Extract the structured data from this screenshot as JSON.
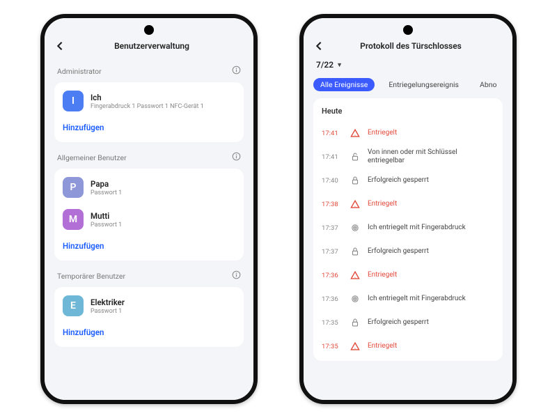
{
  "phone1": {
    "header": "Benutzerverwaltung",
    "sections": {
      "admin": {
        "label": "Administrator",
        "users": [
          {
            "initial": "I",
            "name": "Ich",
            "sub": "Fingerabdruck 1 Passwort 1 NFC-Gerät 1",
            "avatar": "blue"
          }
        ],
        "add": "Hinzufügen"
      },
      "general": {
        "label": "Allgemeiner Benutzer",
        "users": [
          {
            "initial": "P",
            "name": "Papa",
            "sub": "Passwort 1",
            "avatar": "purple"
          },
          {
            "initial": "M",
            "name": "Mutti",
            "sub": "Passwort 1",
            "avatar": "magenta"
          }
        ],
        "add": "Hinzufügen"
      },
      "temp": {
        "label": "Temporärer Benutzer",
        "users": [
          {
            "initial": "E",
            "name": "Elektriker",
            "sub": "Passwort 1",
            "avatar": "teal"
          }
        ],
        "add": "Hinzufügen"
      }
    }
  },
  "phone2": {
    "header": "Protokoll des Türschlosses",
    "date": "7/22",
    "chips": {
      "all": "Alle Ereignisse",
      "unlock": "Entriegelungsereignis",
      "abn": "Abno"
    },
    "log": {
      "day": "Heute",
      "rows": [
        {
          "time": "17:41",
          "icon": "warn",
          "text": "Entriegelt",
          "warn": true
        },
        {
          "time": "17:41",
          "icon": "unlock",
          "text": "Von innen oder mit Schlüssel entriegelbar",
          "warn": false
        },
        {
          "time": "17:40",
          "icon": "lock",
          "text": "Erfolgreich gesperrt",
          "warn": false
        },
        {
          "time": "17:38",
          "icon": "warn",
          "text": "Entriegelt",
          "warn": true
        },
        {
          "time": "17:37",
          "icon": "finger",
          "text": "Ich entriegelt mit Fingerabdruck",
          "warn": false
        },
        {
          "time": "17:37",
          "icon": "lock",
          "text": "Erfolgreich gesperrt",
          "warn": false
        },
        {
          "time": "17:36",
          "icon": "warn",
          "text": "Entriegelt",
          "warn": true
        },
        {
          "time": "17:36",
          "icon": "finger",
          "text": "Ich entriegelt mit Fingerabdruck",
          "warn": false
        },
        {
          "time": "17:35",
          "icon": "lock",
          "text": "Erfolgreich gesperrt",
          "warn": false
        },
        {
          "time": "17:35",
          "icon": "warn",
          "text": "Entriegelt",
          "warn": true
        }
      ]
    }
  }
}
